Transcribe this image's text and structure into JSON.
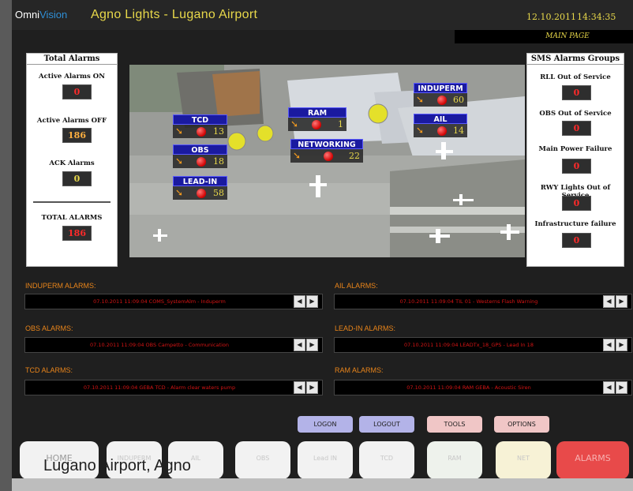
{
  "header": {
    "logo_omni": "Omni",
    "logo_vision": "Vision",
    "title": "Agno Lights - Lugano Airport",
    "date": "12.10.2011",
    "time": "14:34:35",
    "page_tag": "MAIN PAGE"
  },
  "total_alarms": {
    "title": "Total Alarms",
    "active_on_label": "Active Alarms ON",
    "active_on_value": "0",
    "active_off_label": "Active Alarms OFF",
    "active_off_value": "186",
    "ack_label": "ACK Alarms",
    "ack_value": "0",
    "total_label": "TOTAL ALARMS",
    "total_value": "186"
  },
  "sms_groups": {
    "title": "SMS Alarms Groups",
    "items": [
      {
        "label": "RLL Out of Service",
        "value": "0"
      },
      {
        "label": "OBS Out of Service",
        "value": "0"
      },
      {
        "label": "Main Power Failure",
        "value": "0"
      },
      {
        "label": "RWY Lights Out of Service",
        "value": "0"
      },
      {
        "label": "Infrastructure failure",
        "value": "0"
      }
    ]
  },
  "map_tags": [
    {
      "name": "INDUPERM",
      "count": "60"
    },
    {
      "name": "RAM",
      "count": "1"
    },
    {
      "name": "TCD",
      "count": "13"
    },
    {
      "name": "AIL",
      "count": "14"
    },
    {
      "name": "NETWORKING",
      "count": "22"
    },
    {
      "name": "OBS",
      "count": "18"
    },
    {
      "name": "LEAD-IN",
      "count": "58"
    }
  ],
  "alarm_rows": [
    {
      "label": "INDUPERM ALARMS:",
      "message": "07.10.2011 11:09:04 COMS_SystemAlm - Induperm"
    },
    {
      "label": "AIL ALARMS:",
      "message": "07.10.2011 11:09:04 TIL 01 - Westerns Flash Warning"
    },
    {
      "label": "OBS ALARMS:",
      "message": "07.10.2011 11:09:04 OBS Campetto - Communication"
    },
    {
      "label": "LEAD-IN ALARMS:",
      "message": "07.10.2011 11:09:04 LEADTx_18_GPS - Lead In 18"
    },
    {
      "label": "TCD ALARMS:",
      "message": "07.10.2011 11:09:04 GEBA TCD - Alarm clear waters pump"
    },
    {
      "label": "RAM ALARMS:",
      "message": "07.10.2011 11:09:04 RAM GEBA - Acoustic Siren"
    }
  ],
  "nav_prev": "◀",
  "nav_next": "▶",
  "buttons": {
    "logon": "LOGON",
    "logout": "LOGOUT",
    "tools": "TOOLS",
    "options": "OPTIONS"
  },
  "bottom_nav": [
    "HOME",
    "INDUPERM",
    "AIL",
    "OBS",
    "Lead IN",
    "TCD",
    "RAM",
    "NET",
    "ALARMS"
  ],
  "caption": "Lugano Airport, Agno",
  "colors": {
    "accent_yellow": "#e8d84a",
    "alarm_red": "#d41414",
    "label_orange": "#e8841a",
    "tag_blue": "#1a1aa0"
  }
}
